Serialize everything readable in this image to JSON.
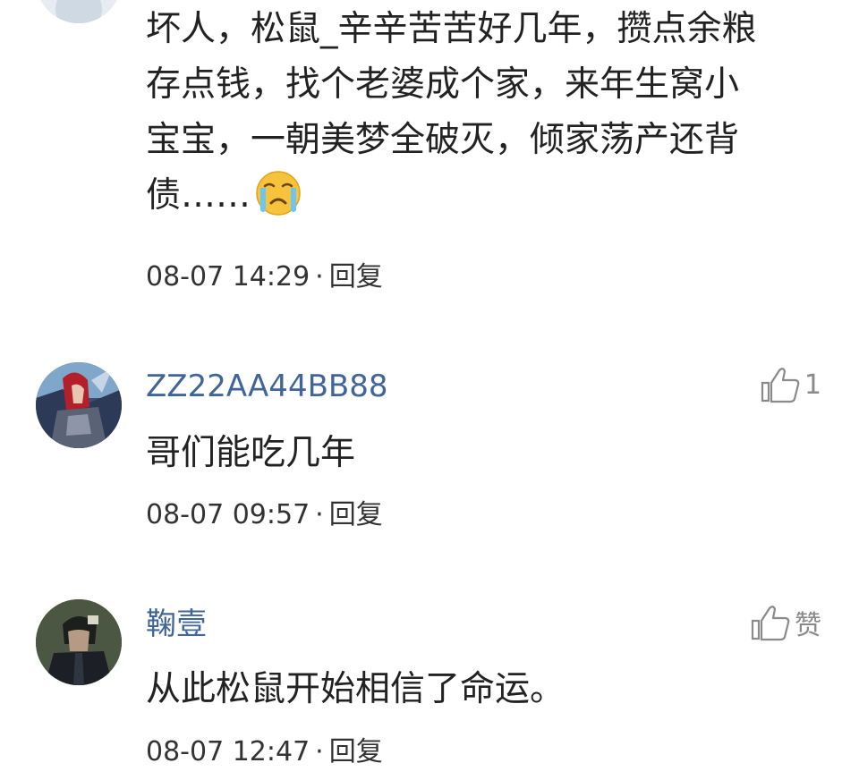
{
  "comments": [
    {
      "body_lines": [
        "坏人，松鼠_辛辛苦苦好几年，攒点余粮",
        "存点钱，找个老婆成个家，来年生窝小",
        "宝宝，一朝美梦全破灭，倾家荡产还背",
        "债……"
      ],
      "emoji": "crying-face-icon",
      "time": "08-07 14:29",
      "separator": "·",
      "reply_label": "回复"
    },
    {
      "username": "ZZ22AA44BB88",
      "body": "哥们能吃几年",
      "time": "08-07 09:57",
      "separator": "·",
      "reply_label": "回复",
      "like_label": "1"
    },
    {
      "username": "鞠壹",
      "body": "从此松鼠开始相信了命运。",
      "time": "08-07 12:47",
      "separator": "·",
      "reply_label": "回复",
      "like_label": "赞"
    }
  ],
  "colors": {
    "username": "#406599",
    "body": "#222222",
    "meta": "#333333",
    "like": "#8a8a8a"
  }
}
